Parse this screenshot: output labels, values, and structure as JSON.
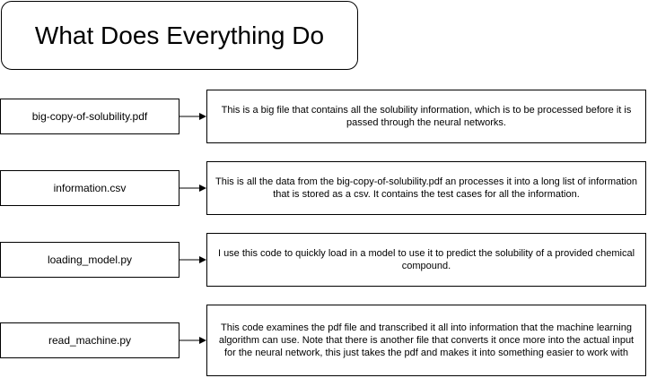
{
  "title": "What Does Everything Do",
  "rows": [
    {
      "file": "big-copy-of-solubility.pdf",
      "description": "This is a big file that contains all the solubility information, which is to be processed before it is passed through the neural networks."
    },
    {
      "file": "information.csv",
      "description": "This is all the data from the big-copy-of-solubility.pdf an processes it into a long list of information that is stored as a csv. It contains the test cases for all the information."
    },
    {
      "file": "loading_model.py",
      "description": "I use this code to quickly load in a model to use it to predict the solubility of a provided chemical compound."
    },
    {
      "file": "read_machine.py",
      "description": "This code examines the pdf file and transcribed it all into information that the machine learning algorithm can use. Note that there is another file that converts it once more into the actual input for the neural network, this just takes the pdf and makes it into something easier to work with"
    }
  ]
}
